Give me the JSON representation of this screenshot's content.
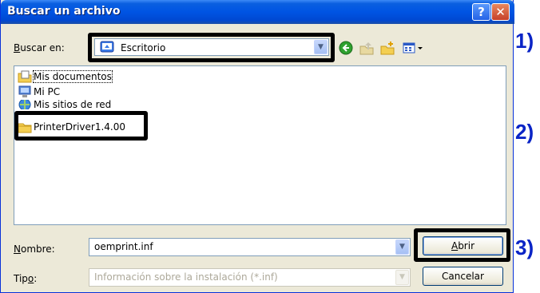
{
  "window": {
    "title": "Buscar un archivo",
    "help_button": "?",
    "close_button": "✕"
  },
  "lookin": {
    "label_mnemonic": "B",
    "label_rest": "uscar en:",
    "value": "Escritorio"
  },
  "toolbar": {
    "icons": [
      "back-icon",
      "up-folder-icon",
      "new-folder-icon",
      "view-menu-icon"
    ]
  },
  "files": [
    {
      "label": "Mis documentos",
      "icon": "my-documents-icon"
    },
    {
      "label": "Mi PC",
      "icon": "my-computer-icon"
    },
    {
      "label": "Mis sitios de red",
      "icon": "network-places-icon"
    },
    {
      "label": "PrinterDriver1.4.00",
      "icon": "folder-icon"
    }
  ],
  "nombre": {
    "label_mnemonic": "N",
    "label_rest": "ombre:",
    "value": "oemprint.inf"
  },
  "tipo": {
    "label_start": "Tip",
    "label_mnemonic": "o",
    "label_end": ":",
    "value": "Información sobre la instalación (*.inf)"
  },
  "buttons": {
    "abrir_mnemonic": "A",
    "abrir_rest": "brir",
    "cancelar": "Cancelar"
  },
  "annotations": [
    "1)",
    "2)",
    "3)"
  ],
  "colors": {
    "annotation_text": "#0a24c6",
    "titlebar": "#0054e3"
  }
}
